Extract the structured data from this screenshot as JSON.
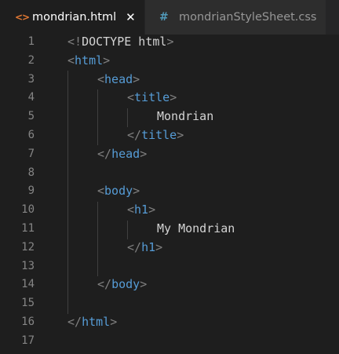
{
  "tabs": [
    {
      "label": "mondrian.html",
      "icon": "html-file-icon",
      "active": true,
      "close_glyph": "✕"
    },
    {
      "label": "mondrianStyleSheet.css",
      "icon": "css-file-icon",
      "active": false
    }
  ],
  "tab_icons": {
    "html": "<>",
    "css": "#"
  },
  "line_numbers": [
    "1",
    "2",
    "3",
    "4",
    "5",
    "6",
    "7",
    "8",
    "9",
    "10",
    "11",
    "12",
    "13",
    "14",
    "15",
    "16",
    "17"
  ],
  "code": {
    "doctype_open": "<!",
    "doctype_text": "DOCTYPE html",
    "doctype_close": ">",
    "tag_html": "html",
    "tag_head": "head",
    "tag_title": "title",
    "title_text": "Mondrian",
    "tag_body": "body",
    "tag_h1": "h1",
    "h1_text": "My Mondrian",
    "lt": "<",
    "gt": ">",
    "lt_slash": "</"
  },
  "colors": {
    "background": "#1e1e1e",
    "tag": "#569cd6",
    "bracket": "#808080",
    "text": "#d4d4d4",
    "line_number": "#858585",
    "html_icon": "#e37933",
    "css_icon": "#519aba"
  }
}
